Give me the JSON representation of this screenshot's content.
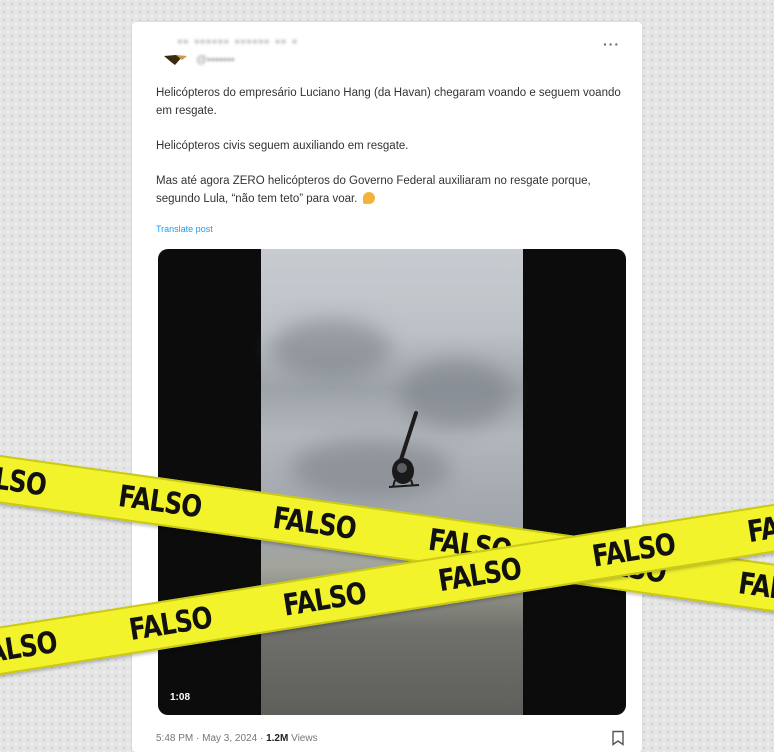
{
  "tweet": {
    "author_name": "▪▪ ▪▪▪▪▪▪ ▪▪▪▪▪▪ ▪▪ ▪",
    "author_handle": "@▪▪▪▪▪▪▪",
    "more_label": "···",
    "text": {
      "paragraph_1": "Helicópteros do empresário Luciano Hang (da Havan) chegaram voando e seguem voando em resgate.",
      "paragraph_2": "Helicópteros civis seguem auxiliando em resgate.",
      "paragraph_3": "Mas até agora ZERO helicópteros do Governo Federal auxiliaram no resgate porque, segundo Lula, “não tem teto” para voar."
    },
    "translate_label": "Translate post",
    "video": {
      "duration": "1:08"
    },
    "footer": {
      "time": "5:48 PM",
      "separator_1": " · ",
      "date": "May 3, 2024",
      "separator_2": " · ",
      "views_count": "1.2M",
      "views_label": " Views"
    }
  },
  "overlay": {
    "tape_word": "FALSO",
    "tape_color": "#f3f32c",
    "text_color": "#111111"
  },
  "icons": {
    "more": "ellipsis-icon",
    "bookmark": "bookmark-icon",
    "emoji": "thinking-face-icon",
    "avatar": "avatar-icon",
    "helicopter": "helicopter-image"
  }
}
